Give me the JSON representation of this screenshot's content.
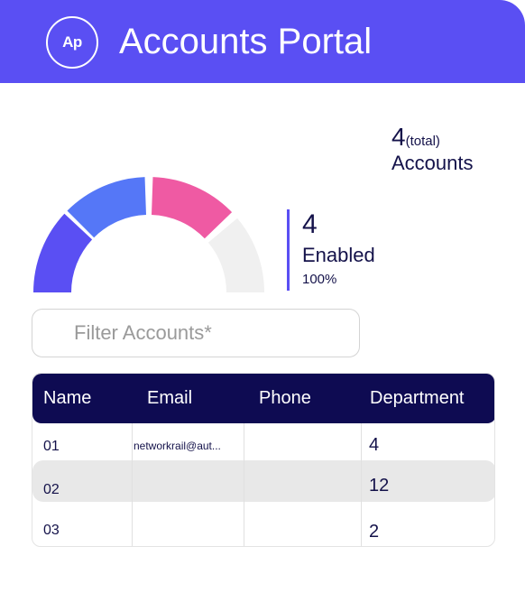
{
  "app": {
    "logo_text": "Ap",
    "title": "Accounts Portal",
    "brand_color": "#5a4ff3"
  },
  "summary": {
    "total_count": "4",
    "total_suffix": "(total)",
    "total_label": "Accounts",
    "enabled_count": "4",
    "enabled_label": "Enabled",
    "enabled_percent": "100%"
  },
  "gauge": {
    "segments": [
      {
        "name": "segment-1",
        "color": "#5a4ff3"
      },
      {
        "name": "segment-2",
        "color": "#5577f7"
      },
      {
        "name": "segment-3",
        "color": "#ef5aa3"
      },
      {
        "name": "segment-4",
        "color": "#f0f0f0"
      }
    ]
  },
  "filter": {
    "placeholder": "Filter Accounts*",
    "value": ""
  },
  "table": {
    "header_color": "#0e0b52",
    "columns": [
      "Name",
      "Email",
      "Phone",
      "Department"
    ],
    "rows": [
      {
        "name": "01",
        "email": "networkrail@aut...",
        "phone": "",
        "department": "4"
      },
      {
        "name": "02",
        "email": "",
        "phone": "",
        "department": "12"
      },
      {
        "name": "03",
        "email": "",
        "phone": "",
        "department": "2"
      }
    ]
  }
}
